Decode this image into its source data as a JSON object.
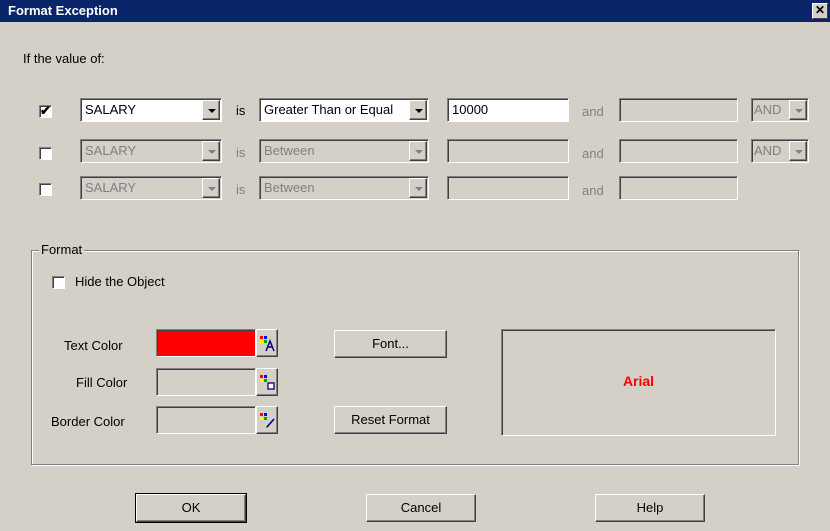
{
  "window": {
    "title": "Format Exception",
    "close_glyph": "✕"
  },
  "intro_label": "If the value of:",
  "conditions": [
    {
      "checked": true,
      "check_glyph": "✔",
      "field": "SALARY",
      "is_label": "is",
      "operator": "Greater Than or Equal",
      "value1": "10000",
      "and_label": "and",
      "value2": "",
      "logic": "AND"
    },
    {
      "checked": false,
      "check_glyph": "",
      "field": "SALARY",
      "is_label": "is",
      "operator": "Between",
      "value1": "",
      "and_label": "and",
      "value2": "",
      "logic": "AND"
    },
    {
      "checked": false,
      "check_glyph": "",
      "field": "SALARY",
      "is_label": "is",
      "operator": "Between",
      "value1": "",
      "and_label": "and",
      "value2": ""
    }
  ],
  "format": {
    "group_label": "Format",
    "hide_object_label": "Hide the Object",
    "text_color_label": "Text Color",
    "fill_color_label": "Fill Color",
    "border_color_label": "Border Color",
    "text_color_value": "#ff0000",
    "font_button": "Font...",
    "reset_button": "Reset Format",
    "preview_text": "Arial",
    "preview_color": "#ff0000"
  },
  "buttons": {
    "ok": "OK",
    "cancel": "Cancel",
    "help": "Help"
  },
  "colors": {
    "title_bar": "#0a246a",
    "dialog_bg": "#d4d0c8"
  }
}
